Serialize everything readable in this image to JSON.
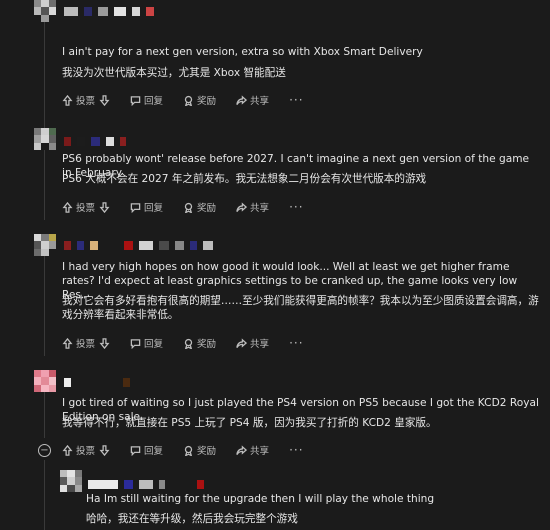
{
  "colors": {
    "background": "#1b1b1b",
    "text": "#e6e6e6",
    "muted": "#bdbdbd"
  },
  "actions": {
    "upvote_label": "投票",
    "reply_label": "回复",
    "award_label": "奖励",
    "share_label": "共享",
    "more_label": "···",
    "upvote_icon": "arrow-up-icon",
    "downvote_icon": "arrow-down-icon",
    "reply_icon": "speech-bubble-icon",
    "award_icon": "award-icon",
    "share_icon": "share-arrow-icon"
  },
  "comments": [
    {
      "text_en": "I ain't pay for a next gen version, extra so with Xbox Smart Delivery",
      "text_zh": "我没为次世代版本买过，尤其是 Xbox 智能配送"
    },
    {
      "text_en": "PS6 probably wont' release before 2027. I can't imagine a next gen version of the game in February",
      "text_zh": "PS6 大概不会在 2027 年之前发布。我无法想象二月份会有次世代版本的游戏"
    },
    {
      "text_en": "I had very high hopes on how good it would look... Well at least we get higher frame rates? I'd expect at least graphics settings to be cranked up, the game looks very low Res..",
      "text_zh": "我对它会有多好看抱有很高的期望……至少我们能获得更高的帧率？我本以为至少图质设置会调高，游戏分辨率看起来非常低。"
    },
    {
      "text_en": "I got tired of waiting so I just played the PS4 version on PS5 because I got the KCD2 Royal Edition on sale.",
      "text_zh": "我等得不行，就直接在 PS5 上玩了 PS4 版，因为我买了打折的 KCD2 皇家版。"
    },
    {
      "text_en": "Ha Im still waiting for the upgrade then I will play the whole thing",
      "text_zh": "哈哈，我还在等升级，然后我会玩完整个游戏"
    }
  ]
}
